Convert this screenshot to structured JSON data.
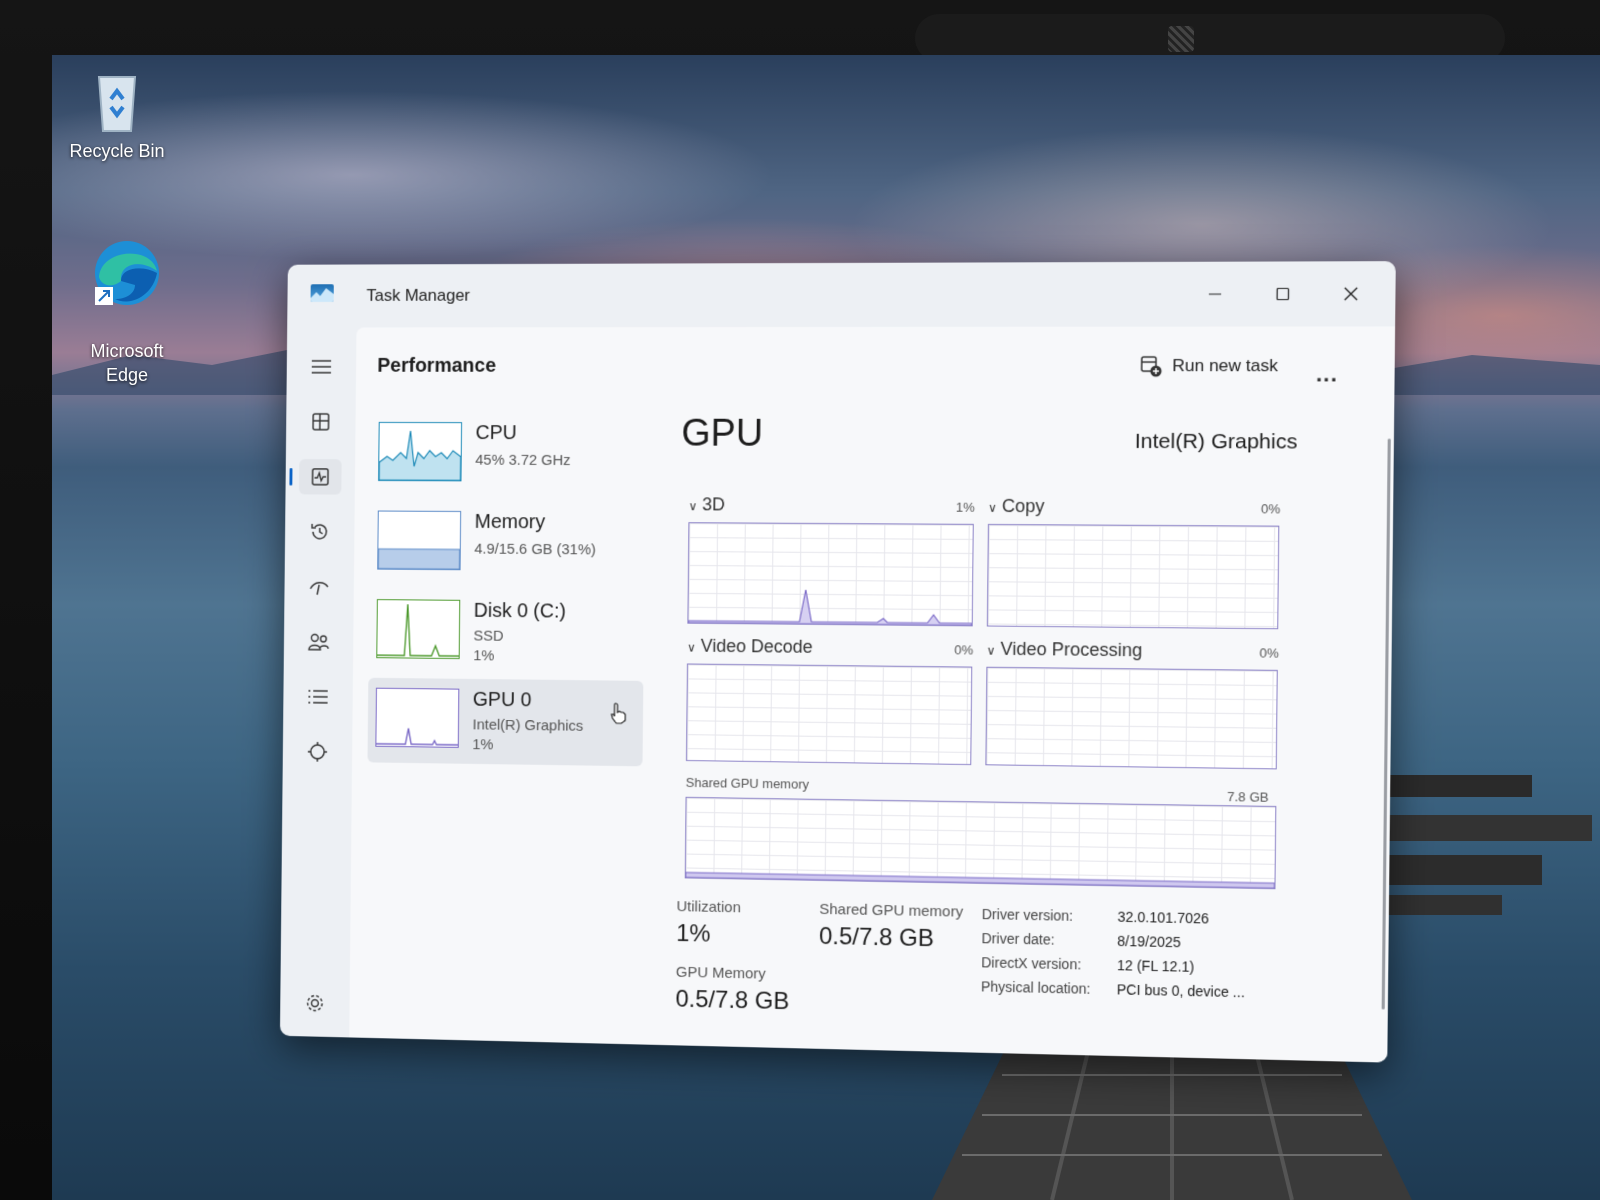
{
  "desktop": {
    "icons": [
      {
        "label": "Recycle Bin",
        "icon": "recycle-bin-icon"
      },
      {
        "label": "Microsoft\nEdge",
        "icon": "edge-icon"
      }
    ]
  },
  "window": {
    "title": "Task Manager",
    "controls": [
      "minimize-icon",
      "maximize-icon",
      "close-icon"
    ]
  },
  "nav": {
    "items": [
      "hamburger-icon",
      "processes-icon",
      "performance-icon",
      "app-history-icon",
      "startup-apps-icon",
      "users-icon",
      "details-icon",
      "services-icon"
    ],
    "active": "performance-icon",
    "settings_icon": "gear-icon"
  },
  "header": {
    "title": "Performance",
    "run_task_label": "Run new task",
    "more_label": "..."
  },
  "resources": [
    {
      "name": "CPU",
      "sub1": "45%  3.72 GHz",
      "sub2": "",
      "sub3": ""
    },
    {
      "name": "Memory",
      "sub1": "4.9/15.6 GB (31%)",
      "sub2": "",
      "sub3": ""
    },
    {
      "name": "Disk 0 (C:)",
      "sub1": "SSD",
      "sub2": "1%",
      "sub3": ""
    },
    {
      "name": "GPU 0",
      "sub1": "Intel(R) Graphics",
      "sub2": "1%",
      "sub3": ""
    }
  ],
  "gpu": {
    "heading": "GPU",
    "adapter": "Intel(R) Graphics",
    "engines": [
      {
        "label": "3D",
        "pct": "1%"
      },
      {
        "label": "Copy",
        "pct": "0%"
      },
      {
        "label": "Video Decode",
        "pct": "0%"
      },
      {
        "label": "Video Processing",
        "pct": "0%"
      }
    ],
    "shared_label": "Shared GPU memory",
    "shared_max": "7.8 GB",
    "stats": {
      "utilization_label": "Utilization",
      "utilization_value": "1%",
      "shared_label": "Shared GPU memory",
      "shared_value": "0.5/7.8 GB",
      "gpu_memory_label": "GPU Memory",
      "gpu_memory_value": "0.5/7.8 GB"
    },
    "info": [
      {
        "key": "Driver version:",
        "value": "32.0.101.7026"
      },
      {
        "key": "Driver date:",
        "value": "8/19/2025"
      },
      {
        "key": "DirectX version:",
        "value": "12 (FL 12.1)"
      },
      {
        "key": "Physical location:",
        "value": "PCI bus 0, device ..."
      }
    ]
  },
  "colors": {
    "accent": "#0a63c7",
    "cpu": "#1b89b7",
    "memory": "#5b8ac7",
    "disk": "#4e9a2e",
    "gpu": "#7b6ac7"
  }
}
